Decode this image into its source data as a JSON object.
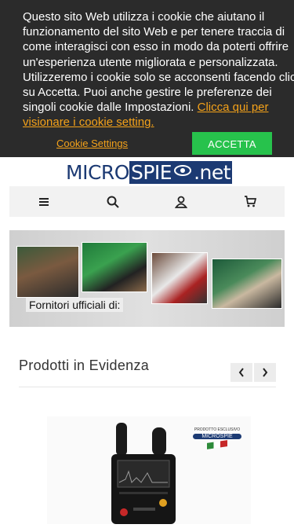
{
  "cookie": {
    "message_lines": [
      "Questo sito Web utilizza i cookie che aiutano il",
      "funzionamento del sito Web e per tenere traccia di",
      "come interagisci con esso in modo da poterti offrire",
      "un'esperienza utente migliorata e personalizzata.",
      "Utilizzeremo i cookie solo se acconsenti facendo clic",
      "su Accetta. Puoi anche gestire le preferenze dei",
      "singoli cookie dalle Impostazioni."
    ],
    "link_text_1": "Clicca qui per",
    "link_text_2": "visionare i cookie setting.",
    "settings_label": "Cookie Settings",
    "accept_label": "ACCETTA",
    "accent_color": "#f4a21a",
    "accept_color": "#27c24c"
  },
  "logo": {
    "part1": "MICRO",
    "part2": "SPIE",
    "part3": ".net"
  },
  "toolbar": {
    "icons": [
      "menu-icon",
      "search-icon",
      "user-icon",
      "cart-icon"
    ]
  },
  "banner": {
    "caption": "Fornitori ufficiali di:"
  },
  "section": {
    "title": "Prodotti in Evidenza",
    "prev": "‹",
    "next": "›"
  },
  "product": {
    "badge_line1": "PRODOTTO ESCLUSIVO",
    "badge_line2": "MICROSPIE"
  }
}
